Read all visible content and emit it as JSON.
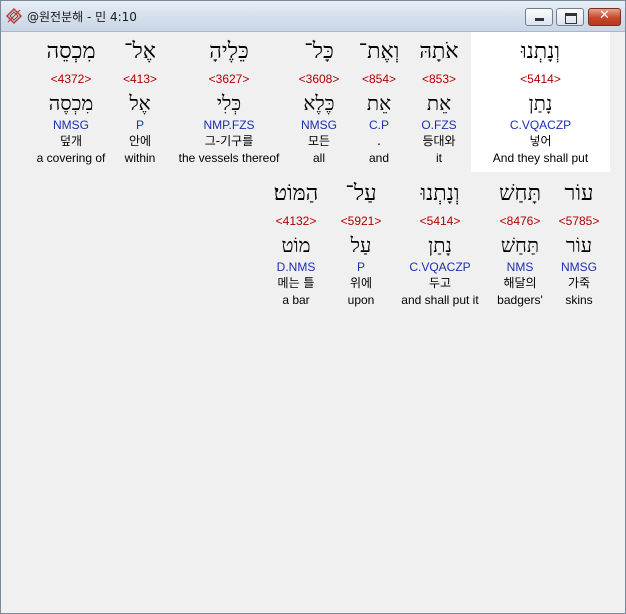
{
  "window": {
    "title": "@원전분해 - 민 4:10"
  },
  "rows": [
    [
      {
        "heb": "וְנָתְנוּ",
        "strong": "<5414>",
        "lemma": "נָתַן",
        "parse": "C.VQACZP",
        "kor": "넣어",
        "eng": "And they shall put"
      },
      {
        "heb": "אֹתָהּ",
        "strong": "<853>",
        "lemma": "אֵת",
        "parse": "O.FZS",
        "kor": "등대와",
        "eng": "it"
      },
      {
        "heb": "וְאֶת־",
        "strong": "<854>",
        "lemma": "אֵת",
        "parse": "C.P",
        "kor": ".",
        "eng": "and"
      },
      {
        "heb": "כָּל־",
        "strong": "<3608>",
        "lemma": "כֶּלֶא",
        "parse": "NMSG",
        "kor": "모든",
        "eng": "all"
      },
      {
        "heb": "כֵּלֶיהָ",
        "strong": "<3627>",
        "lemma": "כְּלִי",
        "parse": "NMP.FZS",
        "kor": "그-기구를",
        "eng": "the vessels thereof"
      },
      {
        "heb": "אֶל־",
        "strong": "<413>",
        "lemma": "אֶל",
        "parse": "P",
        "kor": "안에",
        "eng": "within"
      },
      {
        "heb": "מִכְסֵה",
        "strong": "<4372>",
        "lemma": "מִכְסֶה",
        "parse": "NMSG",
        "kor": "덮개",
        "eng": "a covering of"
      }
    ],
    [
      {
        "heb": "עוֹר",
        "strong": "<5785>",
        "lemma": "עוֹר",
        "parse": "NMSG",
        "kor": "가죽",
        "eng": "skins"
      },
      {
        "heb": "תָּחַשׁ",
        "strong": "<8476>",
        "lemma": "תַּחַשׁ",
        "parse": "NMS",
        "kor": "해달의",
        "eng": "badgers'"
      },
      {
        "heb": "וְנָתְנוּ",
        "strong": "<5414>",
        "lemma": "נָתַן",
        "parse": "C.VQACZP",
        "kor": "두고",
        "eng": "and shall put it"
      },
      {
        "heb": "עַל־",
        "strong": "<5921>",
        "lemma": "עַל",
        "parse": "P",
        "kor": "위에",
        "eng": "upon"
      },
      {
        "heb": "הַמּוֹט׃",
        "strong": "<4132>",
        "lemma": "מוֹט",
        "parse": "D.NMS",
        "kor": "메는 틀",
        "eng": "a bar"
      }
    ]
  ]
}
